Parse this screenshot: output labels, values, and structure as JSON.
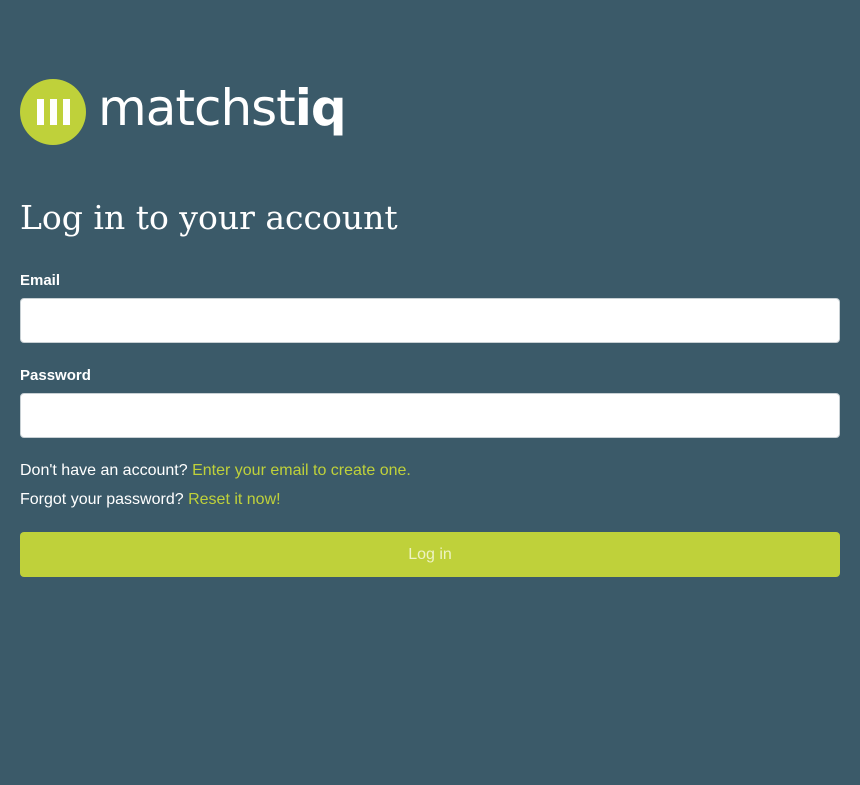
{
  "brand": {
    "name_light": "matchst",
    "name_bold": "iq",
    "accent_color": "#bfd13a",
    "background_color": "#3b5a69"
  },
  "form": {
    "title": "Log in to your account",
    "email": {
      "label": "Email",
      "value": "",
      "placeholder": ""
    },
    "password": {
      "label": "Password",
      "value": "",
      "placeholder": ""
    },
    "signup": {
      "prompt": "Don't have an account?",
      "link": "Enter your email to create one."
    },
    "forgot": {
      "prompt": "Forgot your password?",
      "link": "Reset it now!"
    },
    "submit_label": "Log in"
  }
}
